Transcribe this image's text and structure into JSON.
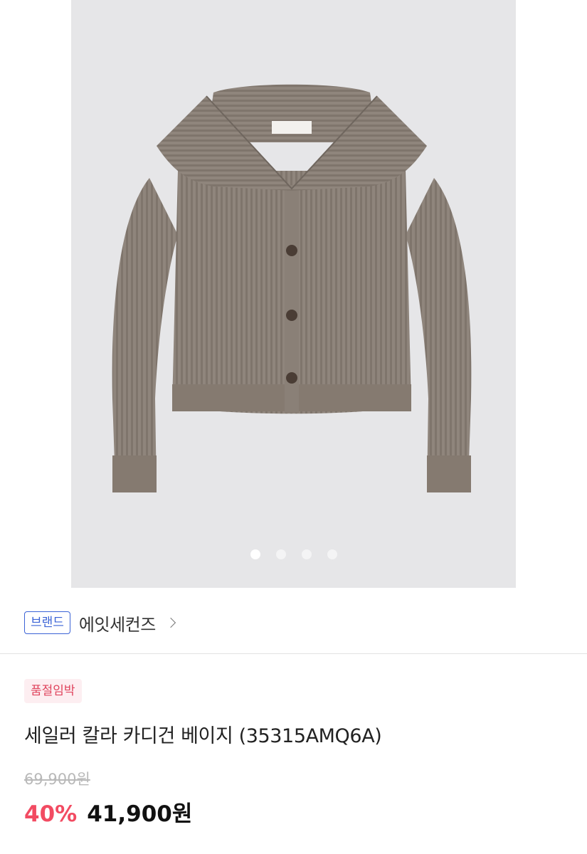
{
  "brand": {
    "badge_label": "브랜드",
    "name": "에잇세컨즈"
  },
  "product": {
    "status_badge": "품절임박",
    "title": "세일러 칼라 카디건  베이지 (35315AMQ6A)",
    "original_price": "69,900원",
    "discount": "40%",
    "sale_price": "41,900원"
  },
  "carousel": {
    "image_count": 4,
    "active_index": 0
  },
  "colors": {
    "brand_accent": "#3b63d6",
    "discount_red": "#f24b62",
    "badge_red": "#e0445d",
    "image_bg": "#e6e6e8",
    "knit_gray": "#8c8178"
  }
}
